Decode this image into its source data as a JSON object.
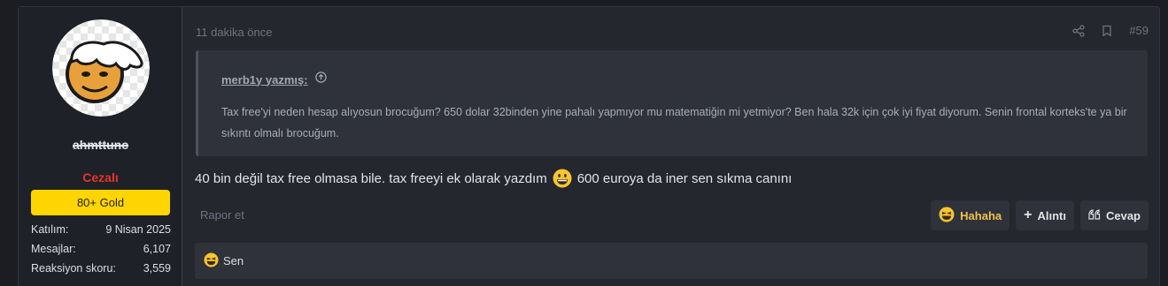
{
  "user": {
    "username": "ahmttunc",
    "title": "Cezalı",
    "badge": "80+ Gold",
    "stats": [
      {
        "label": "Katılım:",
        "value": "9 Nisan 2025"
      },
      {
        "label": "Mesajlar:",
        "value": "6,107"
      },
      {
        "label": "Reaksiyon skoru:",
        "value": "3,559"
      }
    ]
  },
  "post": {
    "time": "11 dakika önce",
    "number": "#59",
    "header_icons": [
      "share-icon",
      "bookmark-icon"
    ],
    "quote": {
      "author": "merb1y yazmış:",
      "text": "Tax free'yi neden hesap alıyosun brocuğum? 650 dolar 32binden yine pahalı yapmıyor mu matematiğin mi yetmiyor? Ben hala 32k için çok iyi fiyat diyorum. Senin frontal korteks'te ya bir sıkıntı olmalı brocuğum."
    },
    "message_before": "40 bin değil tax free olmasa bile. tax freeyi ek olarak yazdım",
    "message_after": "600 euroya da iner sen sıkma canını",
    "report": "Rapor et",
    "actions": {
      "haha": "Hahaha",
      "quote": "Alıntı",
      "reply": "Cevap"
    },
    "reactions_by": "Sen"
  },
  "colors": {
    "accent_gold": "#ffd500",
    "banned_red": "#e8342c",
    "haha_yellow": "#f2c14a"
  }
}
